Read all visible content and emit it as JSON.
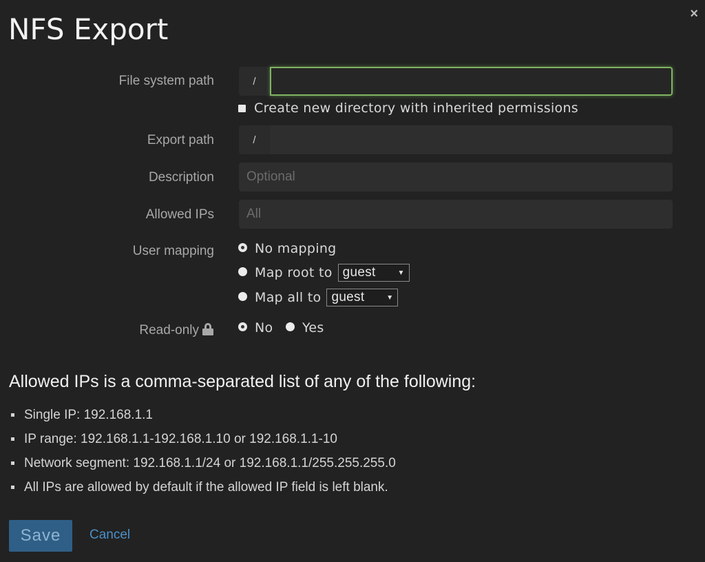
{
  "dialog": {
    "title": "NFS Export",
    "close_label": "×"
  },
  "form": {
    "file_system_path": {
      "label": "File system path",
      "prefix": "/",
      "value": "",
      "placeholder": ""
    },
    "create_directory": {
      "label": "Create new directory with inherited permissions",
      "checked": false
    },
    "export_path": {
      "label": "Export path",
      "prefix": "/",
      "value": "",
      "placeholder": ""
    },
    "description": {
      "label": "Description",
      "value": "",
      "placeholder": "Optional"
    },
    "allowed_ips": {
      "label": "Allowed IPs",
      "value": "",
      "placeholder": "All"
    },
    "user_mapping": {
      "label": "User mapping",
      "options": [
        {
          "label": "No mapping",
          "checked": true
        },
        {
          "label": "Map root to",
          "checked": false,
          "select_value": "guest"
        },
        {
          "label": "Map all to",
          "checked": false,
          "select_value": "guest"
        }
      ]
    },
    "read_only": {
      "label": "Read-only",
      "icon": "lock-icon",
      "options": [
        {
          "label": "No",
          "checked": true
        },
        {
          "label": "Yes",
          "checked": false
        }
      ]
    }
  },
  "help": {
    "title": "Allowed IPs is a comma-separated list of any of the following:",
    "items": [
      "Single IP: 192.168.1.1",
      "IP range: 192.168.1.1-192.168.1.10 or 192.168.1.1-10",
      "Network segment: 192.168.1.1/24 or 192.168.1.1/255.255.255.0",
      "All IPs are allowed by default if the allowed IP field is left blank."
    ]
  },
  "actions": {
    "save_label": "Save",
    "cancel_label": "Cancel"
  },
  "colors": {
    "background": "#222222",
    "focus_border": "#7fb561",
    "save_button": "#2f5f86",
    "link": "#4a90c8"
  }
}
